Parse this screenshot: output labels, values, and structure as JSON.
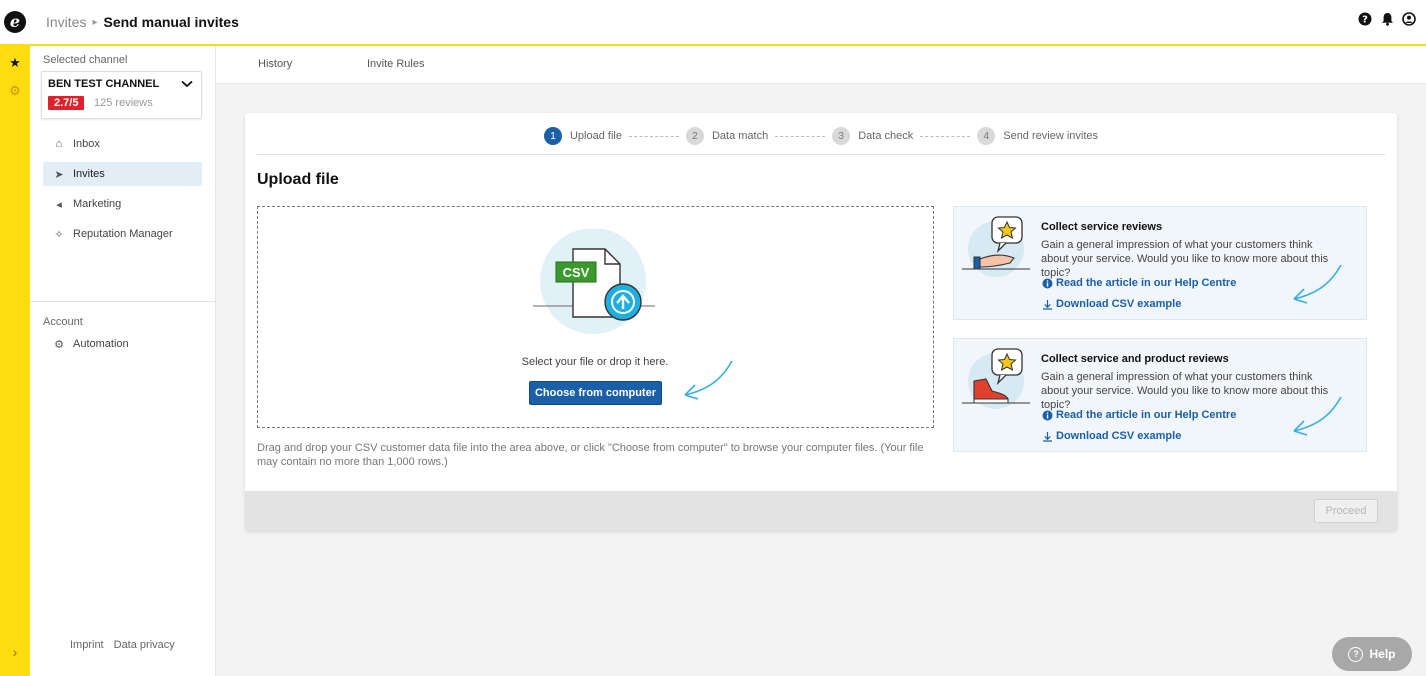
{
  "topbar": {
    "logo_letter": "e",
    "breadcrumb_parent": "Invites",
    "breadcrumb_sep": "▸",
    "breadcrumb_current": "Send manual invites",
    "icons": [
      "help-icon",
      "bell-icon",
      "user-icon"
    ]
  },
  "rail": {
    "star": "★",
    "gear": "⚙",
    "chevron": "›"
  },
  "sidebar": {
    "selected_label": "Selected channel",
    "channel": {
      "name": "BEN TEST CHANNEL",
      "rating": "2.7/5",
      "reviews": "125 reviews"
    },
    "nav": [
      {
        "label": "Inbox",
        "icon": "inbox-icon",
        "glyph": "⌂"
      },
      {
        "label": "Invites",
        "icon": "paper-plane-icon",
        "glyph": "➤"
      },
      {
        "label": "Marketing",
        "icon": "megaphone-icon",
        "glyph": "◂"
      },
      {
        "label": "Reputation Manager",
        "icon": "sparkle-icon",
        "glyph": "✧"
      }
    ],
    "account_label": "Account",
    "account_nav": [
      {
        "label": "Automation",
        "icon": "automation-icon",
        "glyph": "⚙"
      }
    ],
    "footer": {
      "imprint": "Imprint",
      "privacy": "Data privacy"
    }
  },
  "tabs": {
    "history": "History",
    "invite_rules": "Invite Rules"
  },
  "steps": [
    {
      "num": "1",
      "label": "Upload file",
      "active": true
    },
    {
      "num": "2",
      "label": "Data match",
      "active": false
    },
    {
      "num": "3",
      "label": "Data check",
      "active": false
    },
    {
      "num": "4",
      "label": "Send review invites",
      "active": false
    }
  ],
  "upload": {
    "title": "Upload file",
    "csv_label": "CSV",
    "select_text": "Select your file or drop it here.",
    "choose_button": "Choose from computer",
    "help_text": "Drag and drop your CSV customer data file into the area above, or click \"Choose from computer\" to browse your computer files. (Your file may contain no more than 1,000 rows.)"
  },
  "info_boxes": [
    {
      "title": "Collect service reviews",
      "desc": "Gain a general impression of what your customers think about your service. Would you like to know more about this topic?",
      "link_article": "Read the article in our Help Centre",
      "link_csv": "Download CSV example"
    },
    {
      "title": "Collect service and product reviews",
      "desc": "Gain a general impression of what your customers think about your service. Would you like to know more about this topic?",
      "link_article": "Read the article in our Help Centre",
      "link_csv": "Download CSV example"
    }
  ],
  "footer": {
    "proceed": "Proceed"
  },
  "help_fab": {
    "icon_glyph": "?",
    "label": "Help"
  },
  "colors": {
    "accent_yellow": "#ffdc0f",
    "primary_blue": "#1a5fa8",
    "rating_red": "#e0212b",
    "arrow_blue": "#3aaee0"
  }
}
